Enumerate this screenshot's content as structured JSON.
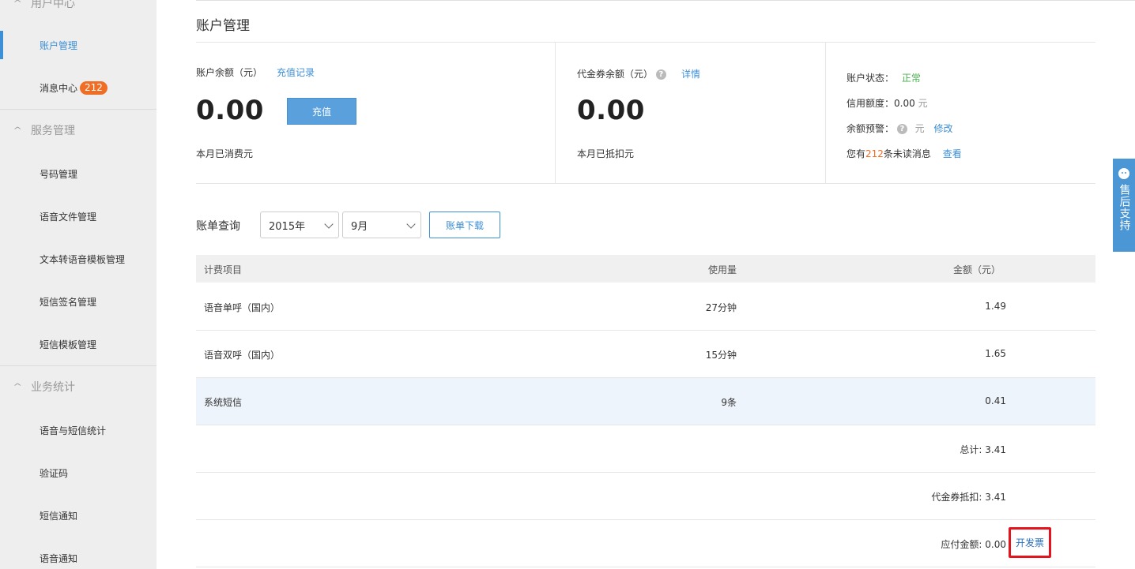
{
  "sidebar": {
    "groups": [
      {
        "title": "用户中心",
        "items": [
          "账户管理",
          "消息中心"
        ]
      },
      {
        "title": "服务管理",
        "items": [
          "号码管理",
          "语音文件管理",
          "文本转语音模板管理",
          "短信签名管理",
          "短信模板管理"
        ]
      },
      {
        "title": "业务统计",
        "items": [
          "语音与短信统计",
          "验证码",
          "短信通知",
          "语音通知"
        ]
      }
    ],
    "message_badge": "212",
    "active_item": "账户管理"
  },
  "page": {
    "title": "账户管理"
  },
  "balance": {
    "label": "账户余额（元）",
    "recharge_record_link": "充值记录",
    "amount": "0.00",
    "recharge_button": "充值",
    "monthly_spent": "本月已消费元"
  },
  "voucher": {
    "label": "代金券余额（元）",
    "detail_link": "详情",
    "amount": "0.00",
    "monthly_deducted": "本月已抵扣元"
  },
  "status": {
    "state_label": "账户状态：",
    "state_value": "正常",
    "credit_label": "信用额度：",
    "credit_value": "0.00",
    "credit_unit": "元",
    "alert_label": "余额预警：",
    "alert_unit": "元",
    "alert_modify_link": "修改",
    "unread_prefix": "您有",
    "unread_count": "212",
    "unread_suffix": "条未读消息",
    "unread_view_link": "查看"
  },
  "bill_query": {
    "label": "账单查询",
    "year_selected": "2015年",
    "month_selected": "9月",
    "download_button": "账单下载"
  },
  "table": {
    "headers": [
      "计费项目",
      "使用量",
      "金额（元）"
    ],
    "rows": [
      {
        "item": "语音单呼（国内）",
        "usage": "27分钟",
        "amount": "1.49"
      },
      {
        "item": "语音双呼（国内）",
        "usage": "15分钟",
        "amount": "1.65"
      },
      {
        "item": "系统短信",
        "usage": "9条",
        "amount": "0.41"
      }
    ],
    "total": "总计: 3.41",
    "voucher_deduct": "代金券抵扣: 3.41",
    "payable": "应付金额: 0.00",
    "invoice_link": "开发票"
  },
  "support_tab": {
    "label": "售后支持"
  },
  "colors": {
    "accent": "#3d8fd6",
    "badge": "#f06d25",
    "status_ok": "#4caf50",
    "highlight_row": "#eef4fb",
    "annotation_box": "#e4141e"
  }
}
